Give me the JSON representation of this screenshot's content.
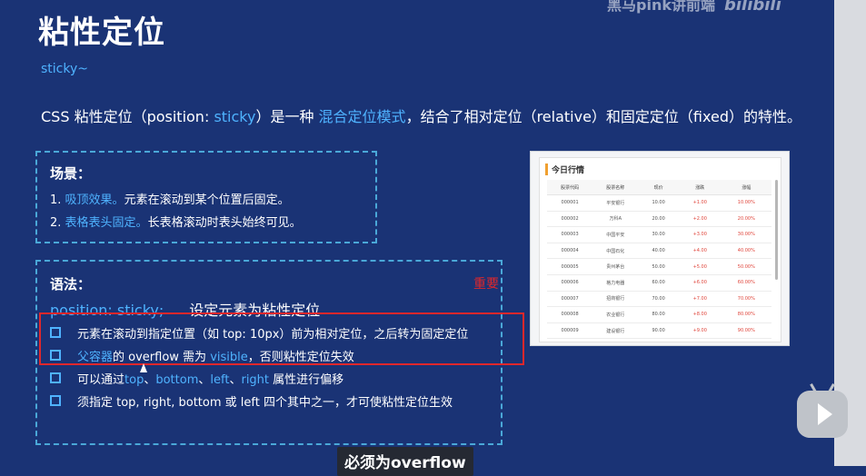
{
  "watermark": {
    "text": "黑马pink讲前端",
    "logo": "bilibili"
  },
  "title": "粘性定位",
  "subtitle": "sticky~",
  "intro": {
    "prefix": "CSS 粘性定位（position: ",
    "code": "sticky",
    "middle": "）是一种 ",
    "highlight": "混合定位模式",
    "suffix": "，结合了相对定位（relative）和固定定位（fixed）的特性。"
  },
  "scenarios": {
    "heading": "场景：",
    "items": [
      {
        "num": "1. ",
        "highlight": "吸顶效果。",
        "text": "元素在滚动到某个位置后固定。"
      },
      {
        "num": "2. ",
        "highlight": "表格表头固定。",
        "text": "长表格滚动时表头始终可见。"
      }
    ]
  },
  "syntax": {
    "heading": "语法：",
    "code": "position: sticky;",
    "description": "设定元素为粘性定位",
    "important_label": "重要",
    "bullets": [
      {
        "text": "元素在滚动到指定位置（如 top: 10px）前为相对定位，之后转为固定定位"
      },
      {
        "part1": "父容器",
        "part2": "的 overflow 需为 ",
        "part3": "visible",
        "part4": "，否则粘性定位失效"
      },
      {
        "part1": "可以通过",
        "part2": "top",
        "part3": "、",
        "part4": "bottom",
        "part5": "、",
        "part6": "left",
        "part7": "、",
        "part8": "right",
        "part9": " 属性进行偏移"
      },
      {
        "text": "须指定 top, right, bottom 或 left 四个其中之一，才可使粘性定位生效"
      }
    ]
  },
  "demo": {
    "title": "今日行情",
    "columns": [
      "股票代码",
      "股票名称",
      "现价",
      "涨跌",
      "涨幅"
    ],
    "rows": [
      [
        "000001",
        "平安银行",
        "10.00",
        "+1.00",
        "10.00%"
      ],
      [
        "000002",
        "万科A",
        "20.00",
        "+2.00",
        "20.00%"
      ],
      [
        "000003",
        "中国平安",
        "30.00",
        "+3.00",
        "30.00%"
      ],
      [
        "000004",
        "中国石化",
        "40.00",
        "+4.00",
        "40.00%"
      ],
      [
        "000005",
        "贵州茅台",
        "50.00",
        "+5.00",
        "50.00%"
      ],
      [
        "000006",
        "格力电器",
        "60.00",
        "+6.00",
        "60.00%"
      ],
      [
        "000007",
        "招商银行",
        "70.00",
        "+7.00",
        "70.00%"
      ],
      [
        "000008",
        "农业银行",
        "80.00",
        "+8.00",
        "80.00%"
      ],
      [
        "000009",
        "建设银行",
        "90.00",
        "+9.00",
        "90.00%"
      ],
      [
        "000010",
        "中国银行",
        "100.00",
        "+10.00",
        "100.00%"
      ]
    ]
  },
  "caption": "必须为overflow",
  "colors": {
    "background": "#1a3375",
    "accent": "#4fb3ff",
    "highlight_box": "#e0272b",
    "dashed_border": "#4aa8d8"
  },
  "icons": [
    "bilibili-tv-icon",
    "play-icon",
    "mouse-cursor-icon"
  ]
}
